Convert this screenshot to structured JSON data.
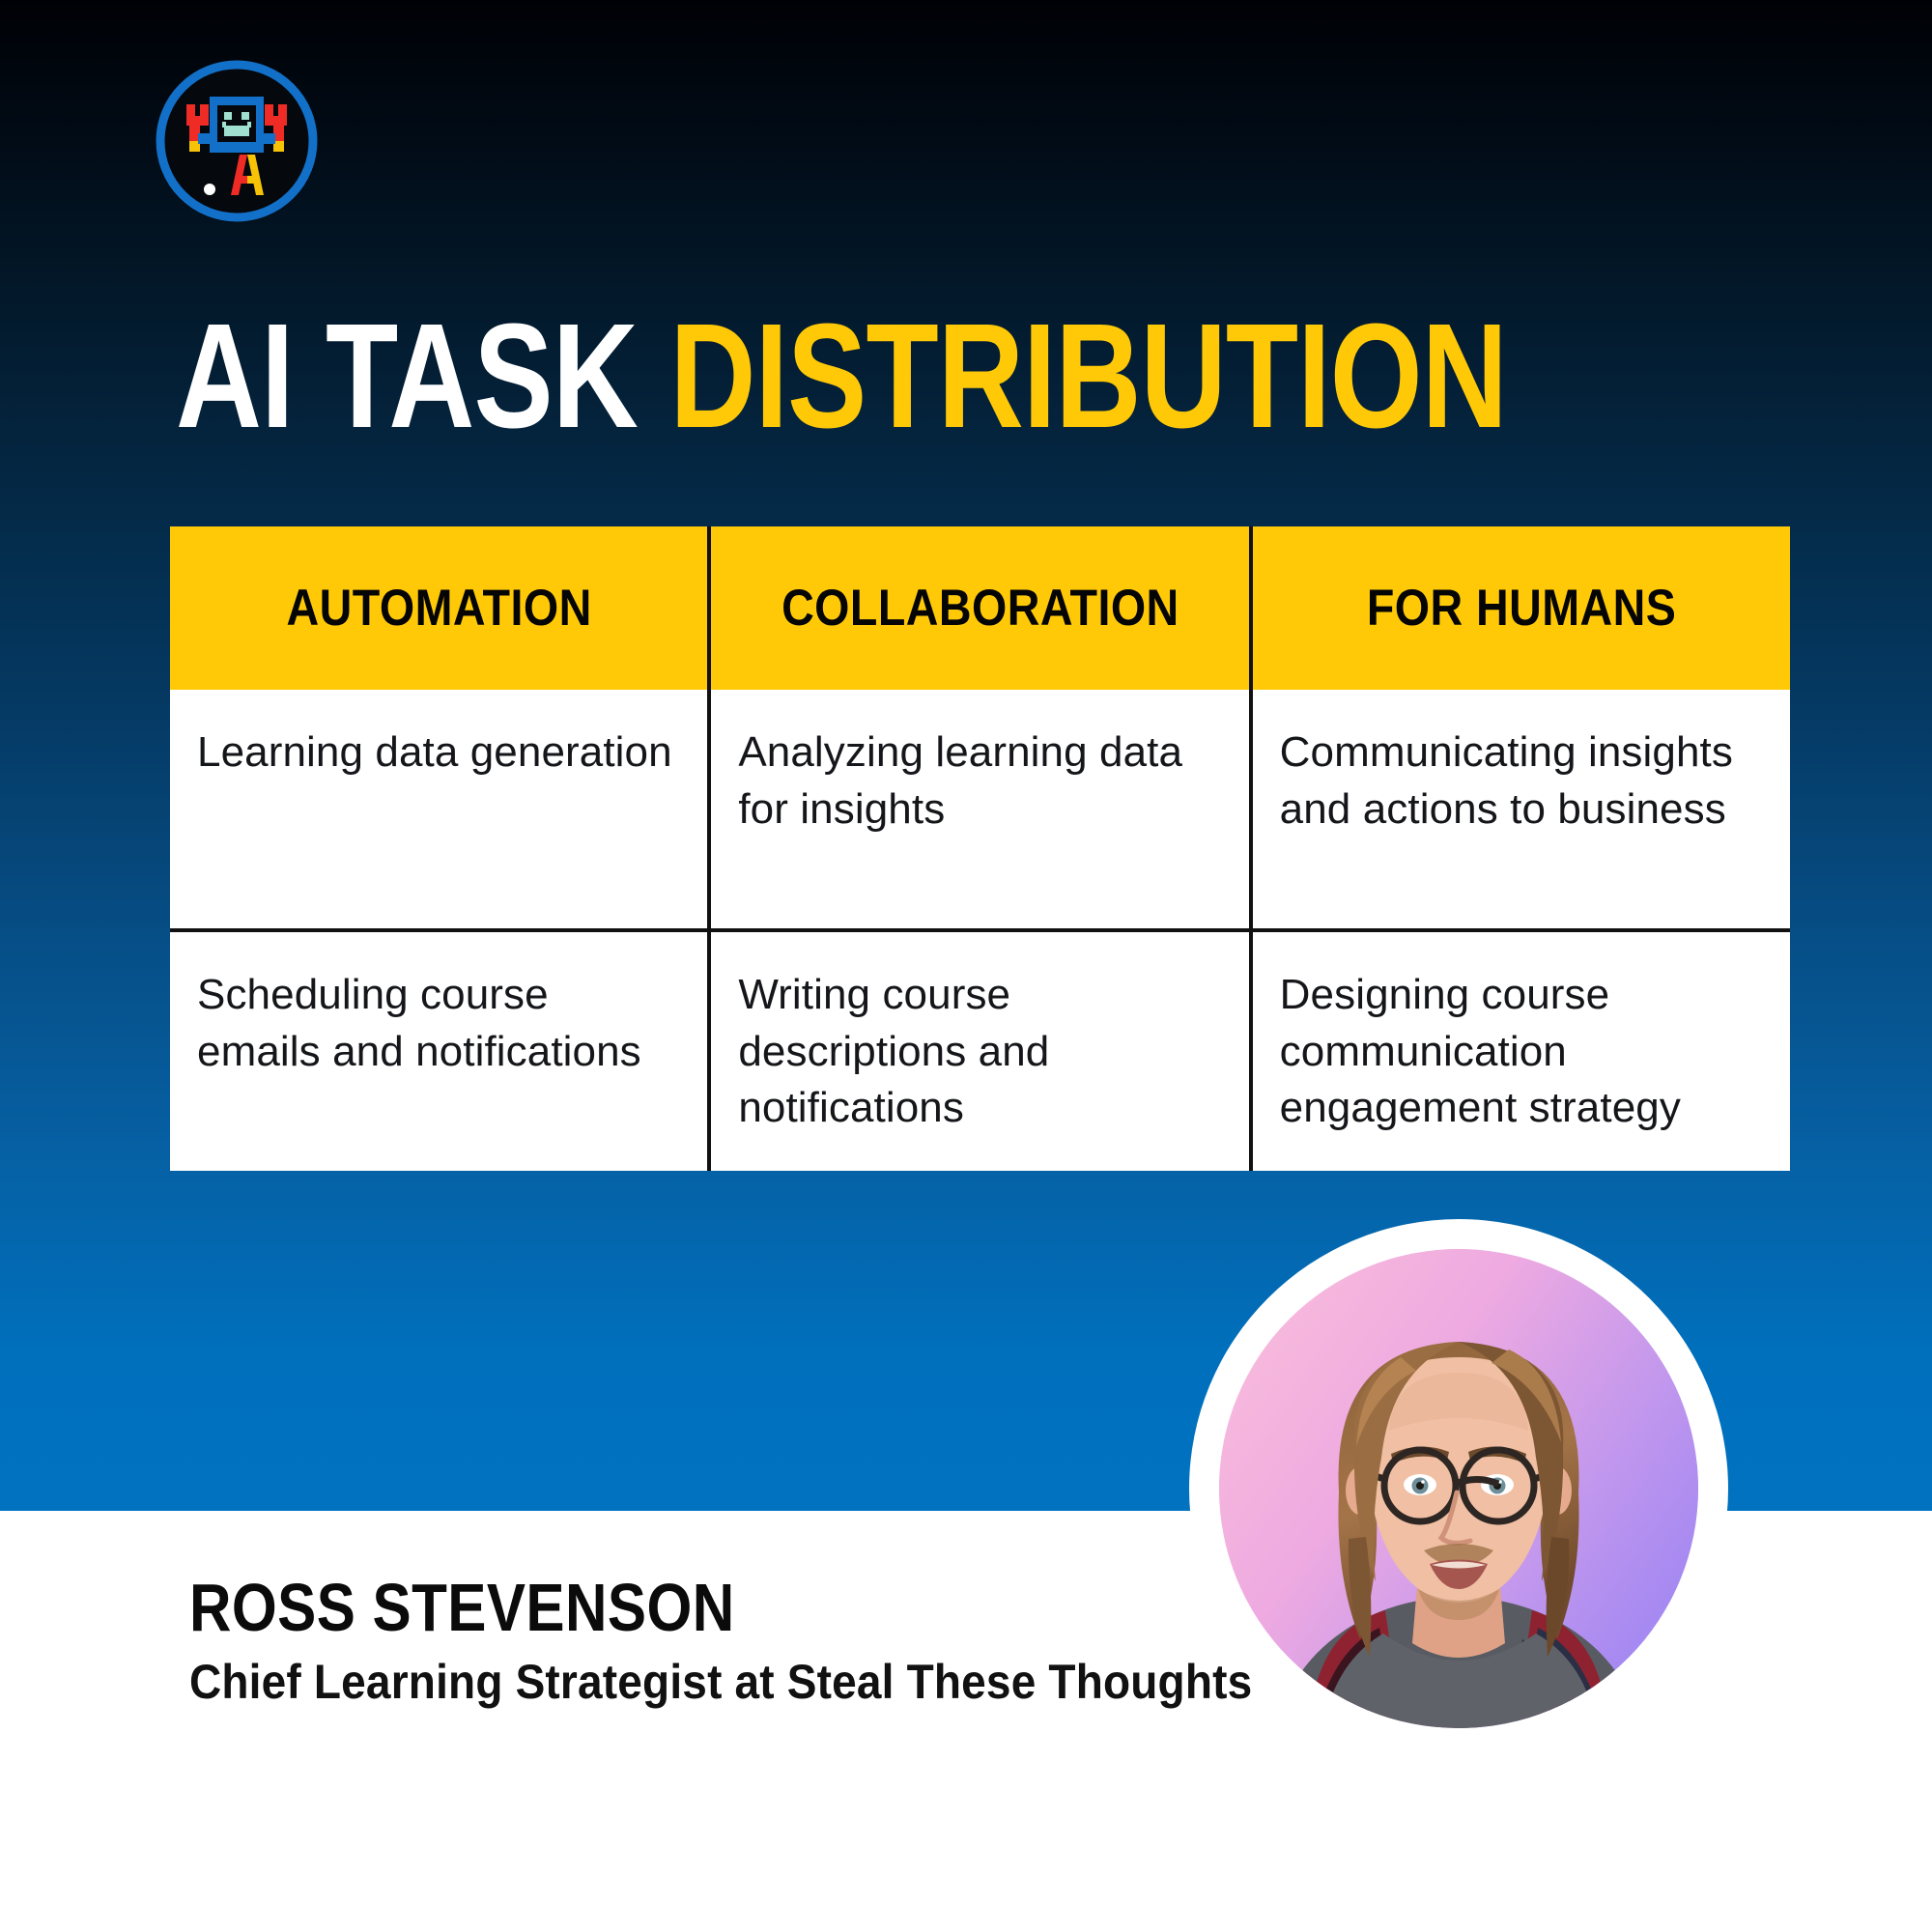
{
  "colors": {
    "accent_yellow": "#FFC907",
    "brand_blue": "#0072c0",
    "logo_blue": "#1270c8",
    "logo_red": "#ef2b26",
    "logo_mint": "#9fe0d0",
    "dark_top": "#000105",
    "text_dark": "#15161a",
    "white": "#ffffff"
  },
  "logo": {
    "name": "ai-robot-logo",
    "alt": "robot holding up arms above a letter A"
  },
  "header": {
    "title_part_1": "AI TASK",
    "title_part_2": "DISTRIBUTION"
  },
  "table": {
    "columns": [
      "AUTOMATION",
      "COLLABORATION",
      "FOR HUMANS"
    ],
    "rows": [
      [
        "Learning data generation",
        "Analyzing learning data for insights",
        "Communicating insights and actions to business"
      ],
      [
        "Scheduling course emails and notifications",
        "Writing course descriptions and notifications",
        "Designing course communication engagement strategy"
      ]
    ]
  },
  "footer": {
    "name": "ROSS STEVENSON",
    "role": "Chief Learning Strategist at Steal These Thoughts",
    "avatar_alt": "portrait of a man with long hair and round glasses"
  }
}
